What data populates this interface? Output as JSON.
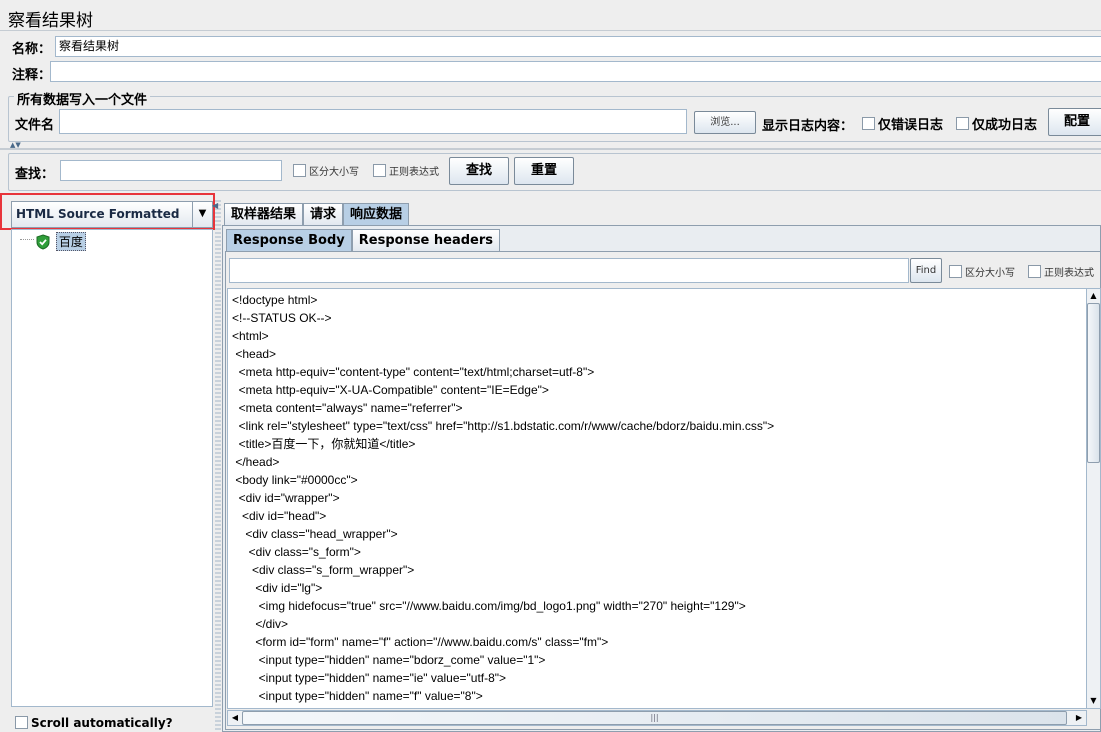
{
  "header": {
    "title": "察看结果树",
    "name_label": "名称：",
    "name_value": "察看结果树",
    "comment_label": "注释："
  },
  "file_section": {
    "group_title": "所有数据写入一个文件",
    "filename_label": "文件名",
    "filename_value": "",
    "browse_button": "浏览...",
    "log_display_label": "显示日志内容：",
    "errors_only_label": "仅错误日志",
    "success_only_label": "仅成功日志",
    "configure_button": "配置"
  },
  "search": {
    "label": "查找：",
    "value": "",
    "case_sensitive_label": "区分大小写",
    "regex_label": "正则表达式",
    "find_button": "查找",
    "reset_button": "重置"
  },
  "renderer": {
    "selected": "HTML Source Formatted"
  },
  "tree": {
    "items": [
      {
        "label": "百度",
        "status": "success"
      }
    ]
  },
  "scroll_auto_label": "Scroll automatically?",
  "result_tabs": [
    {
      "label": "取样器结果",
      "active": false
    },
    {
      "label": "请求",
      "active": false
    },
    {
      "label": "响应数据",
      "active": true
    }
  ],
  "sub_tabs": [
    {
      "label": "Response Body",
      "active": true
    },
    {
      "label": "Response headers",
      "active": false
    }
  ],
  "response_search": {
    "value": "",
    "find_button": "Find",
    "case_sensitive_label": "区分大小写",
    "regex_label": "正则表达式"
  },
  "response_body_lines": [
    "<!doctype html>",
    "<!--STATUS OK-->",
    "<html>",
    " <head>",
    "  <meta http-equiv=\"content-type\" content=\"text/html;charset=utf-8\">",
    "  <meta http-equiv=\"X-UA-Compatible\" content=\"IE=Edge\">",
    "  <meta content=\"always\" name=\"referrer\">",
    "  <link rel=\"stylesheet\" type=\"text/css\" href=\"http://s1.bdstatic.com/r/www/cache/bdorz/baidu.min.css\">",
    "  <title>百度一下，你就知道</title>",
    " </head>",
    " <body link=\"#0000cc\">",
    "  <div id=\"wrapper\">",
    "   <div id=\"head\">",
    "    <div class=\"head_wrapper\">",
    "     <div class=\"s_form\">",
    "      <div class=\"s_form_wrapper\">",
    "       <div id=\"lg\">",
    "        <img hidefocus=\"true\" src=\"//www.baidu.com/img/bd_logo1.png\" width=\"270\" height=\"129\">",
    "       </div>",
    "       <form id=\"form\" name=\"f\" action=\"//www.baidu.com/s\" class=\"fm\">",
    "        <input type=\"hidden\" name=\"bdorz_come\" value=\"1\">",
    "        <input type=\"hidden\" name=\"ie\" value=\"utf-8\">",
    "        <input type=\"hidden\" name=\"f\" value=\"8\">"
  ],
  "highlight_color": "#e8343a",
  "success_color": "#2f9e3a"
}
